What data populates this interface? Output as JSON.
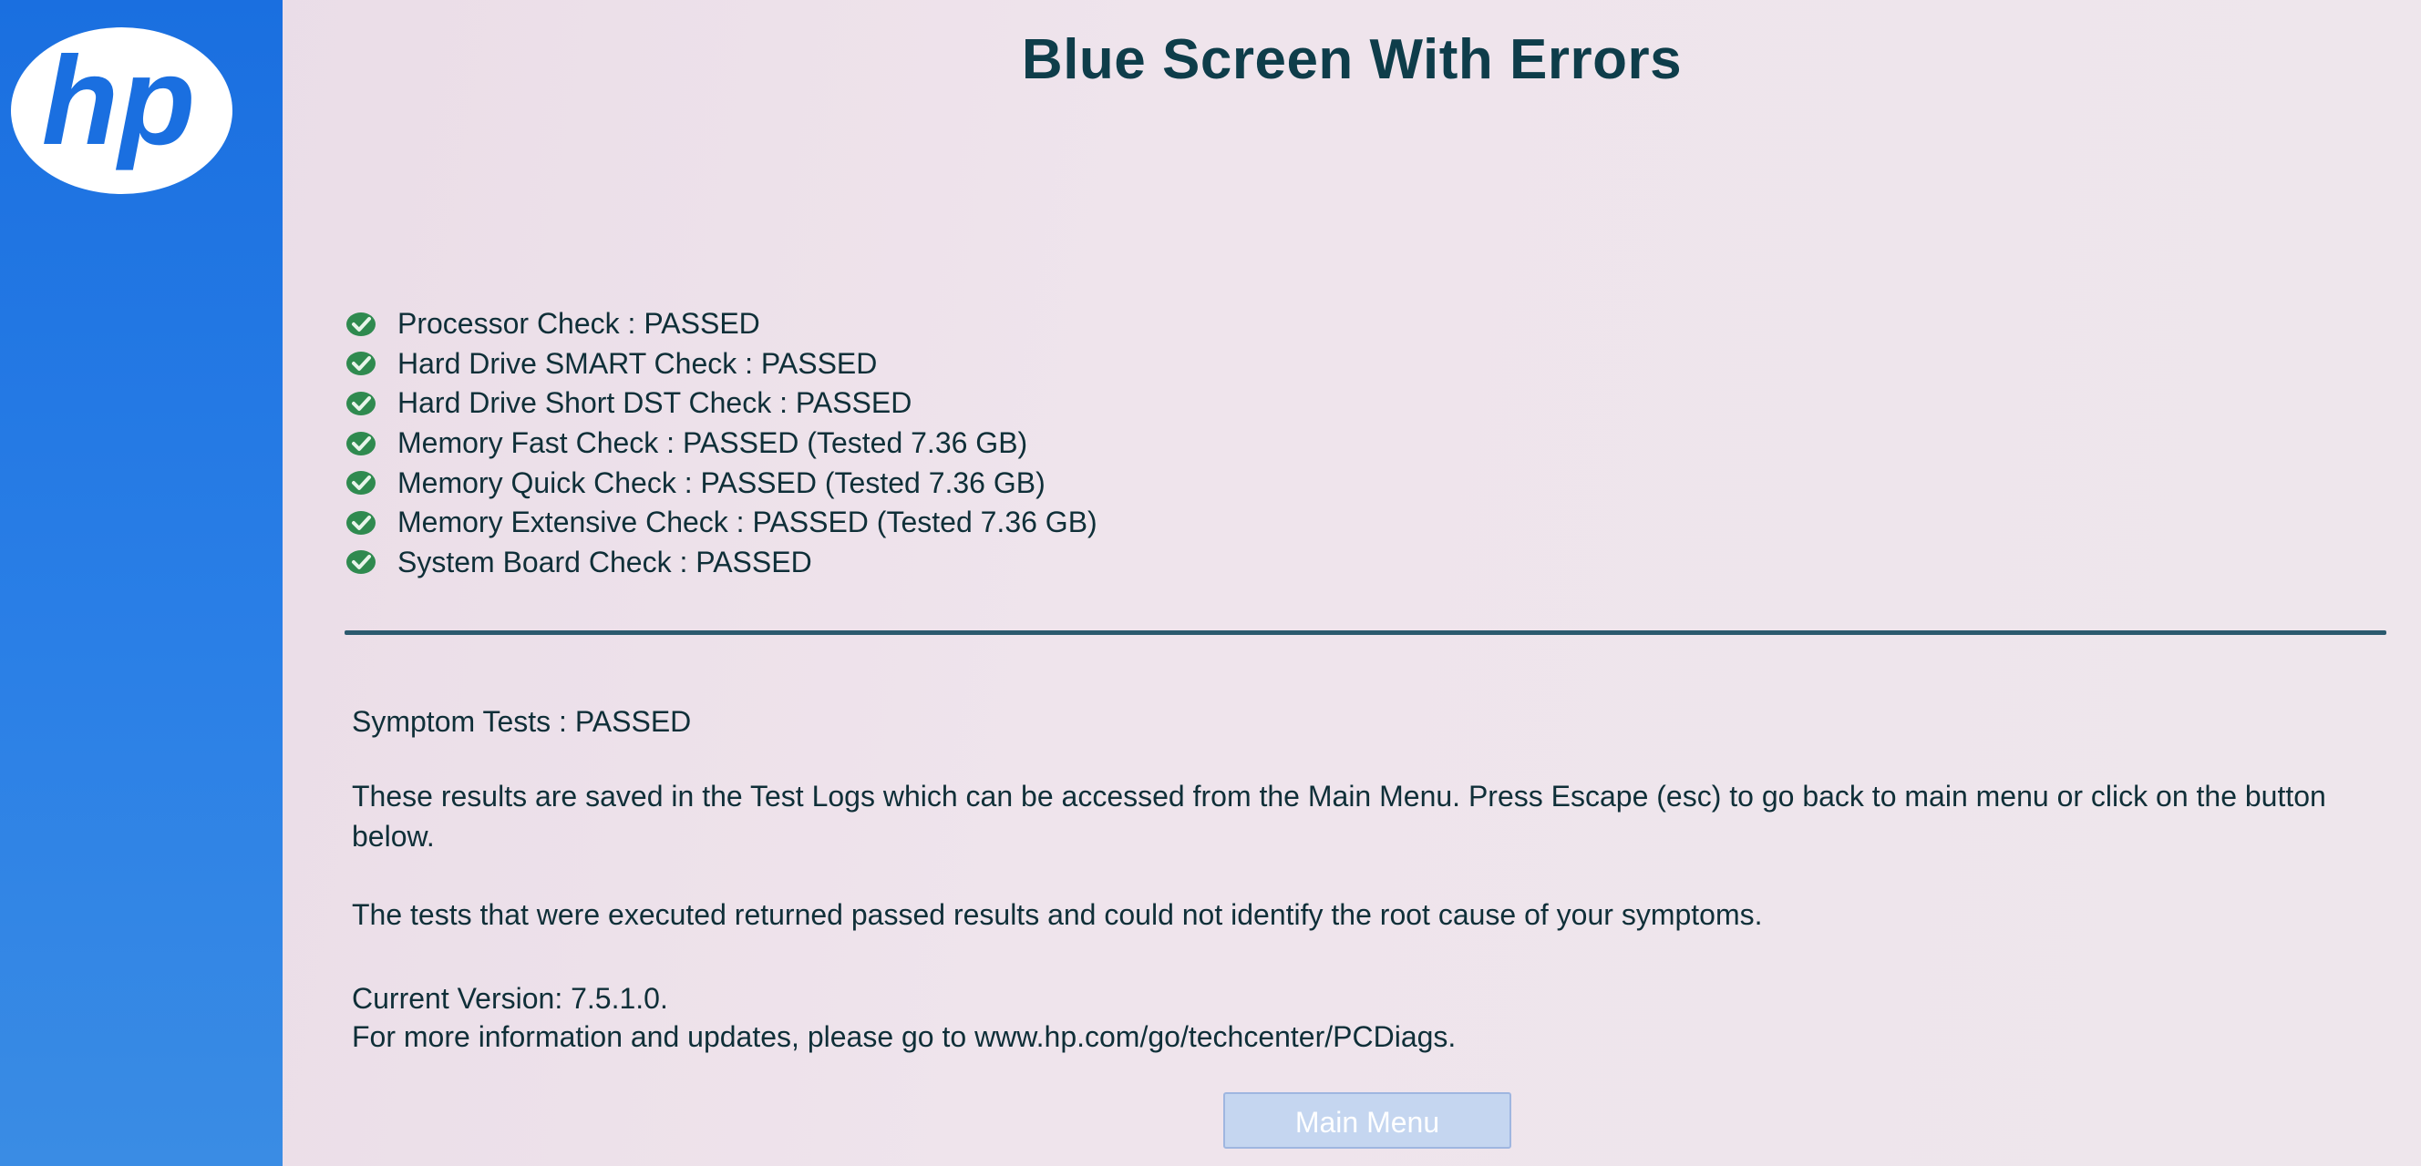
{
  "title": "Blue Screen With Errors",
  "logo": {
    "text": "hp",
    "color": "#1a6fe0"
  },
  "checks": [
    {
      "label": "Processor Check : PASSED",
      "icon": "check-circle-icon",
      "status": "passed"
    },
    {
      "label": "Hard Drive SMART Check : PASSED",
      "icon": "check-circle-icon",
      "status": "passed"
    },
    {
      "label": "Hard Drive Short DST Check : PASSED",
      "icon": "check-circle-icon",
      "status": "passed"
    },
    {
      "label": "Memory Fast Check : PASSED (Tested 7.36 GB)",
      "icon": "check-circle-icon",
      "status": "passed"
    },
    {
      "label": "Memory Quick Check : PASSED (Tested 7.36 GB)",
      "icon": "check-circle-icon",
      "status": "passed"
    },
    {
      "label": "Memory Extensive Check : PASSED (Tested 7.36 GB)",
      "icon": "check-circle-icon",
      "status": "passed"
    },
    {
      "label": "System Board Check : PASSED",
      "icon": "check-circle-icon",
      "status": "passed"
    }
  ],
  "symptom_tests": "Symptom Tests : PASSED",
  "saved_info": "These results are saved in the Test Logs which can be accessed from the Main Menu. Press Escape (esc) to go back to main menu or click on the button below.",
  "root_cause": "The tests that were executed returned passed results and could not identify the root cause of your symptoms.",
  "version": "Current Version: 7.5.1.0.",
  "more_info": "For more information and updates, please go to www.hp.com/go/techcenter/PCDiags.",
  "main_menu_button": "Main Menu",
  "colors": {
    "sidebar": "#1a6fe0",
    "check_icon": "#2f8a4f",
    "title": "#0e3d4a",
    "divider": "#2b5a6e",
    "button": "#c5d6f0"
  }
}
